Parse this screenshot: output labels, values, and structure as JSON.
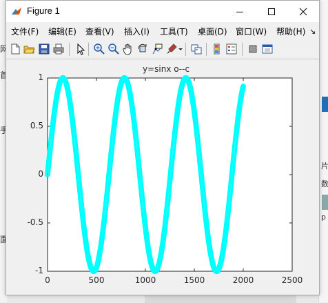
{
  "window": {
    "title": "Figure 1"
  },
  "menu": [
    {
      "label": "文件(F)"
    },
    {
      "label": "编辑(E)"
    },
    {
      "label": "查看(V)"
    },
    {
      "label": "插入(I)"
    },
    {
      "label": "工具(T)"
    },
    {
      "label": "桌面(D)"
    },
    {
      "label": "窗口(W)"
    },
    {
      "label": "帮助(H)"
    }
  ],
  "toolbar_icons": [
    "new-figure-icon",
    "open-file-icon",
    "save-icon",
    "print-icon",
    "edit-plot-arrow-icon",
    "zoom-in-icon",
    "zoom-out-icon",
    "pan-hand-icon",
    "rotate-3d-icon",
    "data-cursor-icon",
    "brush-icon",
    "brush-dropdown-icon",
    "link-plot-icon",
    "insert-colorbar-icon",
    "insert-legend-icon",
    "hide-plot-tools-icon",
    "show-plot-tools-icon"
  ],
  "colors": {
    "series": "#00ffff",
    "axes": "#262626",
    "window_bg": "#f0f0f0"
  },
  "chart_data": {
    "type": "line",
    "title": "y=sinx o--c",
    "xlabel": "",
    "ylabel": "",
    "xlim": [
      0,
      2500
    ],
    "ylim": [
      -1,
      1
    ],
    "xticks": [
      0,
      500,
      1000,
      1500,
      2000,
      2500
    ],
    "yticks": [
      -1,
      -0.5,
      0,
      0.5,
      1
    ],
    "xtick_labels": [
      "0",
      "500",
      "1000",
      "1500",
      "2000",
      "2500"
    ],
    "ytick_labels": [
      "-1",
      "-0.5",
      "0",
      "0.5",
      "1"
    ],
    "series": [
      {
        "function": "sin",
        "x_start": 0,
        "x_end": 2000,
        "x_step": 1,
        "period": 628.3,
        "marker": "o",
        "line_style": "--",
        "color": "#00ffff"
      }
    ],
    "box": true,
    "grid": false
  }
}
